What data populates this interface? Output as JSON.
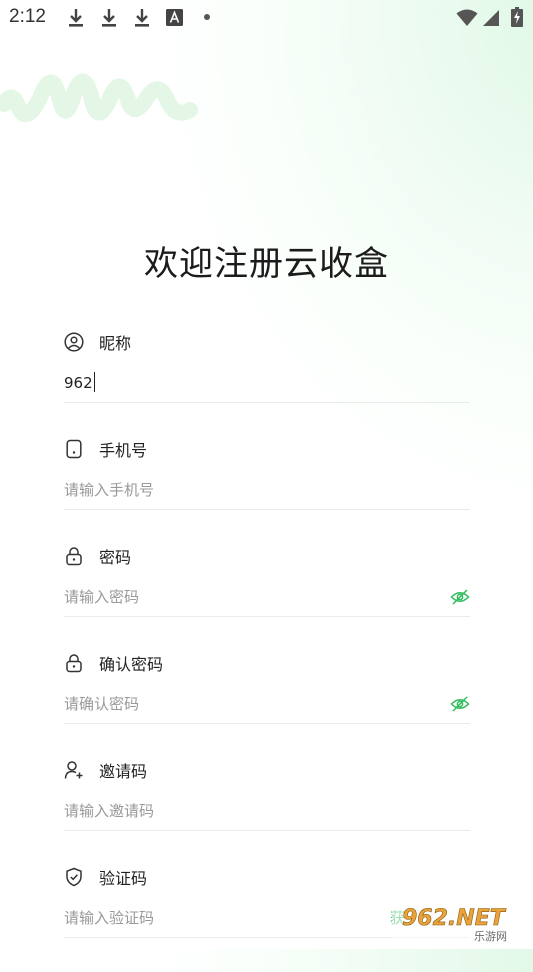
{
  "status_bar": {
    "time": "2:12"
  },
  "title": "欢迎注册云收盒",
  "fields": [
    {
      "label": "昵称",
      "value": "962",
      "placeholder": ""
    },
    {
      "label": "手机号",
      "value": "",
      "placeholder": "请输入手机号"
    },
    {
      "label": "密码",
      "value": "",
      "placeholder": "请输入密码"
    },
    {
      "label": "确认密码",
      "value": "",
      "placeholder": "请确认密码"
    },
    {
      "label": "邀请码",
      "value": "",
      "placeholder": "请输入邀请码"
    },
    {
      "label": "验证码",
      "value": "",
      "placeholder": "请输入验证码"
    }
  ],
  "watermark": {
    "partial_text": "获",
    "logo_text": "962.NET",
    "logo_sub": "乐游网"
  },
  "colors": {
    "accent": "#2ebd5a",
    "brush": "#e4f7e6"
  }
}
